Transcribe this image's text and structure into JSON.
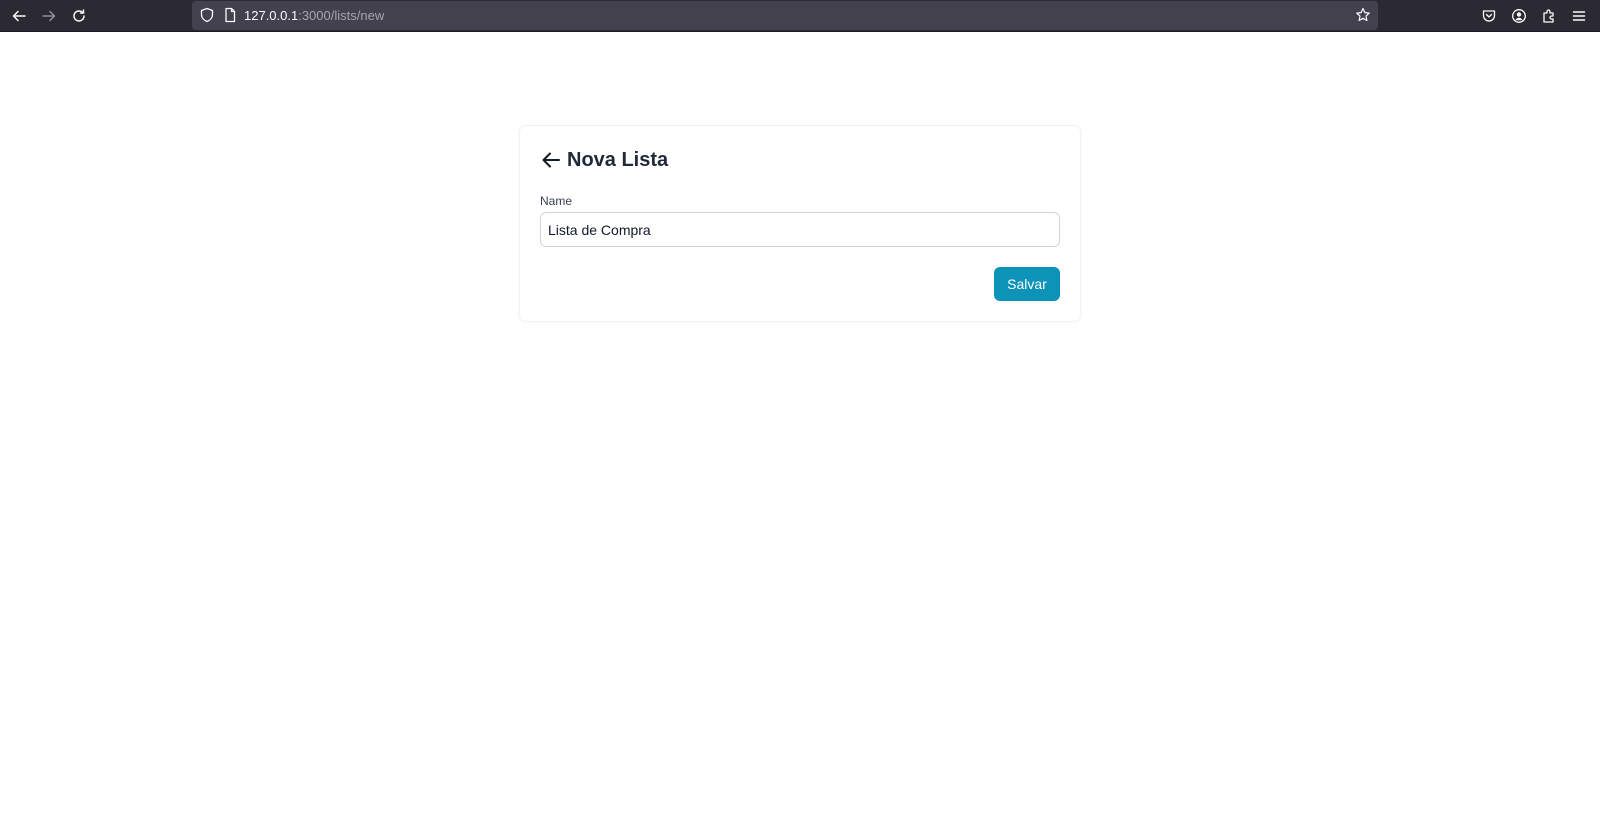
{
  "browser": {
    "url_host": "127.0.0.1",
    "url_rest": ":3000/lists/new",
    "icons": [
      "back-icon",
      "forward-icon",
      "reload-icon",
      "shield-icon",
      "page-icon",
      "star-icon",
      "pocket-icon",
      "account-icon",
      "extensions-icon",
      "menu-icon"
    ]
  },
  "form": {
    "title": "Nova Lista",
    "name_label": "Name",
    "name_value": "Lista de Compra",
    "save_label": "Salvar"
  },
  "colors": {
    "toolbar_bg": "#2b2a33",
    "urlbar_bg": "#42414d",
    "accent": "#0e93b8",
    "title_text": "#1f2937"
  }
}
